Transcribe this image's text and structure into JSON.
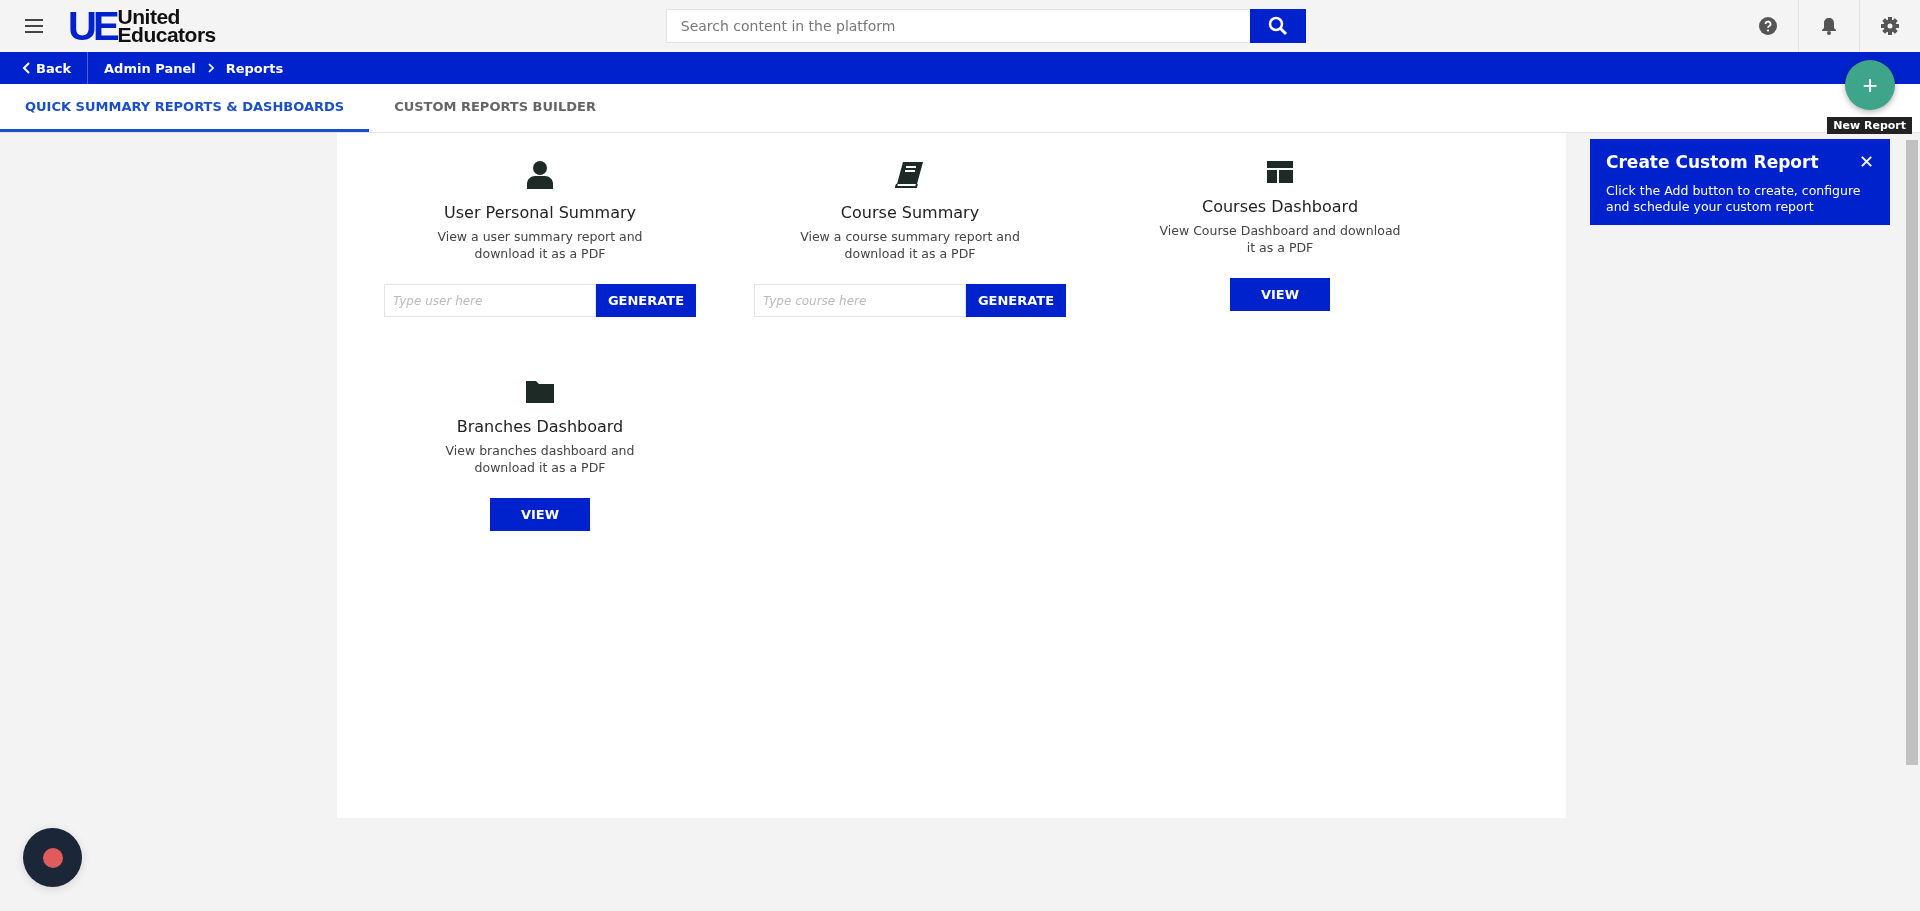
{
  "header": {
    "logo": {
      "mark": "UE",
      "name_lines": [
        "United",
        "Educators"
      ]
    },
    "search": {
      "placeholder": "Search content in the platform"
    }
  },
  "breadcrumb": {
    "back": "Back",
    "items": [
      "Admin Panel",
      "Reports"
    ]
  },
  "tabs": [
    {
      "label": "QUICK SUMMARY REPORTS & DASHBOARDS",
      "selected": true
    },
    {
      "label": "CUSTOM REPORTS BUILDER",
      "selected": false
    }
  ],
  "reports": [
    {
      "title": "User Personal Summary",
      "description": "View a user summary report and download it as a PDF",
      "kind": "generate",
      "placeholder": "Type user here",
      "button": "GENERATE"
    },
    {
      "title": "Course Summary",
      "description": "View a course summary report and download it as a PDF",
      "kind": "generate",
      "placeholder": "Type course here",
      "button": "GENERATE"
    },
    {
      "title": "Courses Dashboard",
      "description": "View Course Dashboard and download it as a PDF",
      "kind": "view",
      "button": "VIEW"
    },
    {
      "title": "Branches Dashboard",
      "description": "View branches dashboard and download it as a PDF",
      "kind": "view",
      "button": "VIEW"
    }
  ],
  "new_report": {
    "fab_label": "+",
    "tooltip": "New Report"
  },
  "popover": {
    "title": "Create Custom Report",
    "close": "✕",
    "text": "Click the Add button to create, configure and schedule your custom report"
  }
}
